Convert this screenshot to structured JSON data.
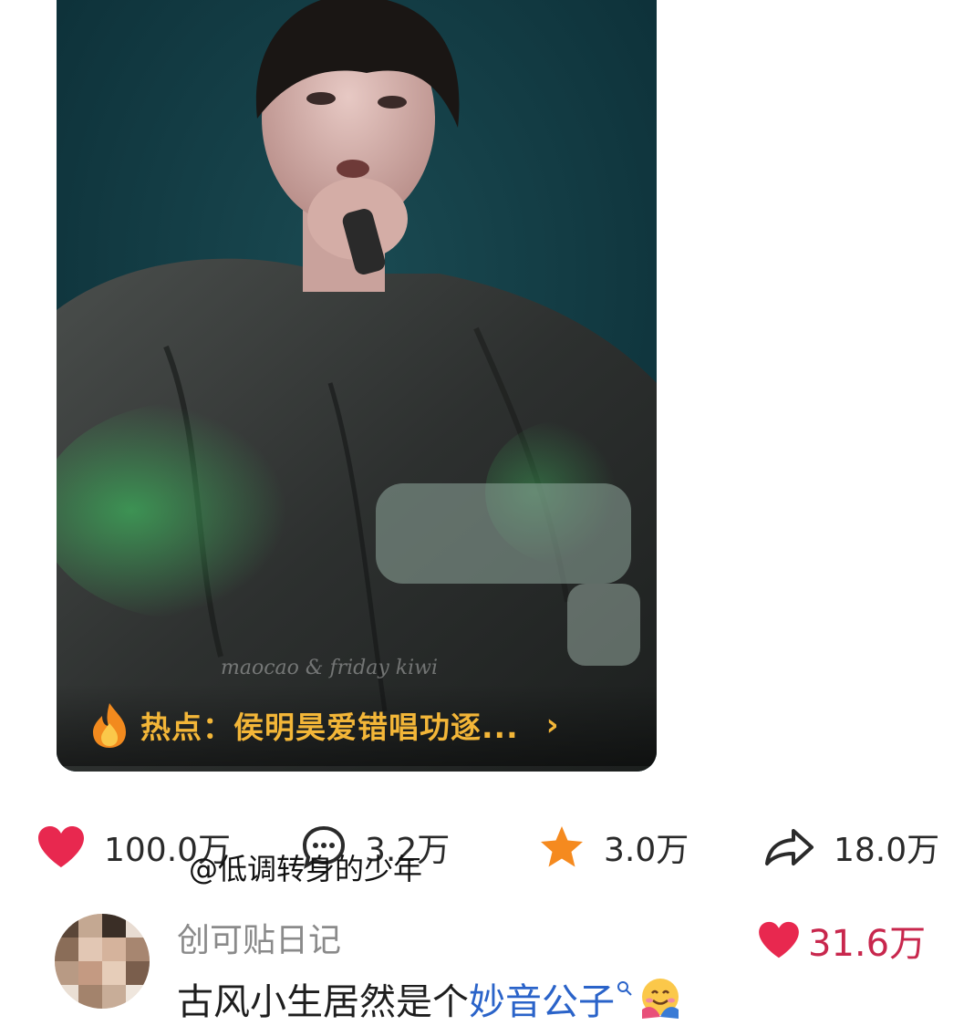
{
  "video": {
    "watermark": "maocao & friday kiwi",
    "hot_topic": "热点：侯明昊爱错唱功逐...",
    "hot_chevron": "›"
  },
  "stats": {
    "likes": "100.0万",
    "comments": "3.2万",
    "favorites": "3.0万",
    "shares": "18.0万"
  },
  "mention": "@低调转身的少年",
  "comment": {
    "username": "创可贴日记",
    "text": "古风小生居然是个",
    "link_text": "妙音公子",
    "likes": "31.6万"
  },
  "colors": {
    "like_red": "#e8284f",
    "star_orange": "#f58a1f",
    "hot_yellow": "#f3b638",
    "link_blue": "#2a63c9",
    "comment_like_red": "#c8274d"
  },
  "icons": {
    "like": "heart-icon",
    "comment": "comment-bubble-icon",
    "favorite": "star-icon",
    "share": "share-arrow-icon",
    "hot": "fire-icon",
    "search": "search-icon",
    "emoji": "hug-emoji-icon"
  }
}
